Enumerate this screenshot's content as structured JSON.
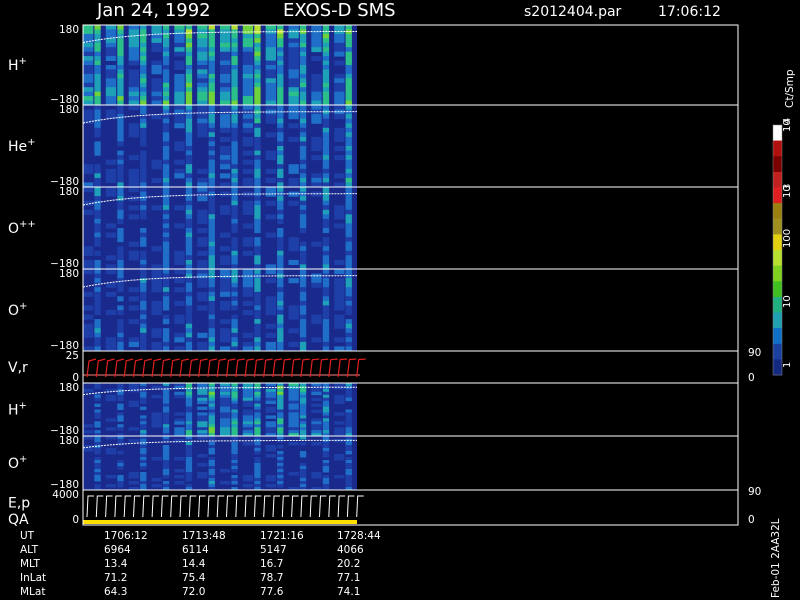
{
  "header": {
    "date": "Jan 24, 1992",
    "mission": "EXOS-D SMS",
    "file": "s2012404.par",
    "time": "17:06:12"
  },
  "colors": {
    "background": "#000000",
    "spectrogram_bg": "#1a2a8c",
    "frame": "#ffffff",
    "velocity_trace": "#e02020",
    "qa_bar": "#ffe000"
  },
  "colorbar": {
    "unit": "Ct/Smp",
    "tick_labels": [
      "10",
      "4",
      "10",
      "3",
      "100",
      "10",
      "1"
    ],
    "scale": "log",
    "range": [
      1,
      10000
    ]
  },
  "chart_data": {
    "type": "heatmap",
    "description_source": "spectrogram stack",
    "panels": [
      {
        "label": "H",
        "superscript": "+",
        "ymax_label": "180",
        "ymin_label": "−180",
        "intensity": [
          3,
          2.6,
          2.4,
          2.8,
          2.2,
          2.5,
          2.3,
          2.4,
          2.6,
          3.0,
          3.2,
          3.1,
          3.0,
          2.9,
          3.2,
          3.3,
          3.0,
          2.8,
          2.6,
          2.4,
          2.3,
          2.6,
          2.2,
          2.7
        ]
      },
      {
        "label": "He",
        "superscript": "+",
        "ymax_label": "180",
        "ymin_label": "−180",
        "intensity": [
          0.8,
          0.9,
          0.8,
          0.7,
          0.7,
          0.8,
          0.8,
          0.9,
          1.0,
          1.4,
          1.5,
          1.4,
          1.3,
          1.4,
          1.5,
          1.6,
          1.4,
          1.3,
          1.2,
          1.3,
          1.2,
          1.1,
          1.2,
          1.5
        ]
      },
      {
        "label": "O",
        "superscript": "++",
        "ymax_label": "180",
        "ymin_label": "−180",
        "intensity": [
          0.6,
          0.7,
          0.7,
          0.6,
          0.6,
          0.6,
          0.7,
          0.7,
          0.8,
          1.0,
          1.1,
          1.0,
          1.0,
          1.0,
          1.1,
          1.1,
          1.0,
          1.0,
          0.9,
          0.9,
          0.9,
          0.9,
          0.9,
          1.0
        ]
      },
      {
        "label": "O",
        "superscript": "+",
        "ymax_label": "180",
        "ymin_label": "−180",
        "intensity": [
          0.8,
          0.9,
          0.8,
          0.7,
          0.8,
          0.7,
          0.8,
          0.9,
          1.0,
          1.2,
          1.3,
          1.2,
          1.2,
          1.2,
          1.3,
          1.3,
          1.2,
          1.2,
          1.1,
          1.0,
          1.1,
          1.0,
          1.0,
          1.2
        ]
      },
      {
        "label": "V,r",
        "superscript": "",
        "ymax_label": "25",
        "ymin_label": "0",
        "right_top": "90",
        "right_bottom": "0",
        "kind": "line"
      },
      {
        "label": "H",
        "superscript": "+",
        "ymax_label": "180",
        "ymin_label": "−180",
        "intensity": [
          0.5,
          0.6,
          0.6,
          0.7,
          0.6,
          0.6,
          0.8,
          0.9,
          1.4,
          1.9,
          2.4,
          2.6,
          2.5,
          2.3,
          2.2,
          2.0,
          1.8,
          2.4,
          2.6,
          1.7,
          1.5,
          1.2,
          1.0,
          0.9
        ]
      },
      {
        "label": "O",
        "superscript": "+",
        "ymax_label": "180",
        "ymin_label": "−180",
        "intensity": [
          0.4,
          0.4,
          0.4,
          0.4,
          0.4,
          0.5,
          0.5,
          0.5,
          0.5,
          0.6,
          0.7,
          0.7,
          0.6,
          0.6,
          0.6,
          0.6,
          0.5,
          0.5,
          0.5,
          0.5,
          0.5,
          0.5,
          0.5,
          0.5
        ]
      },
      {
        "label": "E,p",
        "label2": "QA",
        "superscript": "",
        "ymax_label": "4000",
        "ymin_label": "0",
        "right_top": "90",
        "right_bottom": "0",
        "kind": "line"
      }
    ],
    "x_tick_labels": [
      "1706:12",
      "1713:48",
      "1721:16",
      "1728:44"
    ]
  },
  "orbit_table": {
    "rows": [
      {
        "name": "UT",
        "values": [
          "1706:12",
          "1713:48",
          "1721:16",
          "1728:44"
        ]
      },
      {
        "name": "ALT",
        "values": [
          "6964",
          "6114",
          "5147",
          "4066"
        ]
      },
      {
        "name": "MLT",
        "values": [
          "13.4",
          "14.4",
          "16.7",
          "20.2"
        ]
      },
      {
        "name": "InLat",
        "values": [
          "71.2",
          "75.4",
          "78.7",
          "77.1"
        ]
      },
      {
        "name": "MLat",
        "values": [
          "64.3",
          "72.0",
          "77.6",
          "74.1"
        ]
      }
    ]
  },
  "footer_stamp": "Feb-01 2AA32L"
}
